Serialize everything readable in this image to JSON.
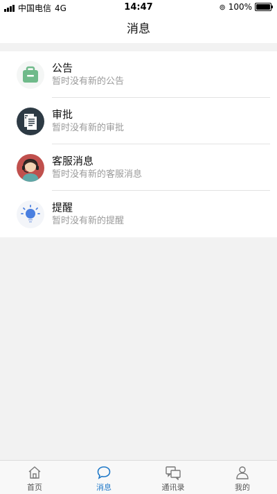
{
  "status_bar": {
    "carrier": "中国电信",
    "network": "4G",
    "time": "14:47",
    "battery": "100%"
  },
  "header": {
    "title": "消息"
  },
  "messages": [
    {
      "title": "公告",
      "subtitle": "暂时没有新的公告",
      "icon": "announcement-bag-icon",
      "color": "#6fba8a"
    },
    {
      "title": "审批",
      "subtitle": "暂时没有新的审批",
      "icon": "approval-document-icon",
      "color": "#2d3a44"
    },
    {
      "title": "客服消息",
      "subtitle": "暂时没有新的客服消息",
      "icon": "customer-service-headset-icon",
      "color": "#c0504d"
    },
    {
      "title": "提醒",
      "subtitle": "暂时没有新的提醒",
      "icon": "reminder-lightbulb-icon",
      "color": "#4a7fe0"
    }
  ],
  "tabbar": {
    "active": "消息",
    "active_color": "#1e78c8",
    "items": [
      {
        "label": "首页",
        "icon": "home-icon"
      },
      {
        "label": "消息",
        "icon": "chat-bubble-icon"
      },
      {
        "label": "通讯录",
        "icon": "contacts-icon"
      },
      {
        "label": "我的",
        "icon": "person-icon"
      }
    ]
  }
}
